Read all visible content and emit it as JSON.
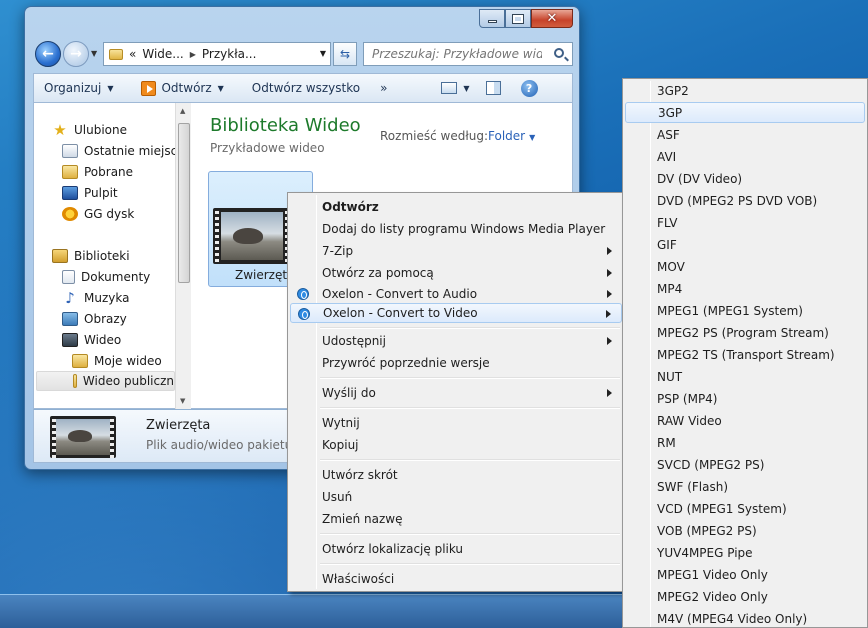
{
  "window": {
    "nav": {
      "back_icon": "back-arrow-icon",
      "forward_icon": "forward-arrow-icon"
    },
    "address": {
      "prefix": "«",
      "crumbs": [
        "Wide...",
        "Przykła..."
      ]
    },
    "search": {
      "placeholder": "Przeszukaj: Przykładowe wideo"
    },
    "toolbar": {
      "organize": "Organizuj",
      "play": "Odtwórz",
      "play_all": "Odtwórz wszystko",
      "more": "»"
    },
    "sidebar": {
      "favorites": [
        {
          "label": "Ulubione",
          "icon": "star-icon"
        },
        {
          "label": "Ostatnie miejsca",
          "icon": "recent-places-icon"
        },
        {
          "label": "Pobrane",
          "icon": "downloads-folder-icon"
        },
        {
          "label": "Pulpit",
          "icon": "desktop-icon"
        },
        {
          "label": "GG dysk",
          "icon": "gg-drive-icon"
        }
      ],
      "libraries": [
        {
          "label": "Biblioteki",
          "icon": "libraries-icon"
        },
        {
          "label": "Dokumenty",
          "icon": "documents-icon"
        },
        {
          "label": "Muzyka",
          "icon": "music-icon"
        },
        {
          "label": "Obrazy",
          "icon": "pictures-icon"
        },
        {
          "label": "Wideo",
          "icon": "videos-icon"
        },
        {
          "label": "Moje wideo",
          "icon": "folder-icon"
        },
        {
          "label": "Wideo publiczn",
          "icon": "folder-icon",
          "selected": true
        }
      ]
    },
    "library": {
      "title": "Biblioteka Wideo",
      "subtitle": "Przykładowe wideo",
      "arrange_label": "Rozmieść według:",
      "arrange_value": "Folder"
    },
    "file": {
      "name": "Zwierzęta"
    },
    "details": {
      "name": "Zwierzęta",
      "type": "Plik audio/wideo pakietu W"
    }
  },
  "context_menu": {
    "items": [
      {
        "label": "Odtwórz",
        "bold": true
      },
      {
        "label": "Dodaj do listy programu Windows Media Player"
      },
      {
        "label": "7-Zip",
        "submenu": true
      },
      {
        "label": "Otwórz za pomocą",
        "submenu": true
      },
      {
        "label": "Oxelon - Convert to Audio",
        "submenu": true,
        "icon": "oxelon-icon"
      },
      {
        "label": "Oxelon - Convert to Video",
        "submenu": true,
        "icon": "oxelon-icon",
        "highlighted": true
      },
      {
        "label": "Udostępnij",
        "submenu": true
      },
      {
        "label": "Przywróć poprzednie wersje"
      },
      {
        "label": "Wyślij do",
        "submenu": true
      },
      {
        "label": "Wytnij"
      },
      {
        "label": "Kopiuj"
      },
      {
        "label": "Utwórz skrót"
      },
      {
        "label": "Usuń"
      },
      {
        "label": "Zmień nazwę"
      },
      {
        "label": "Otwórz lokalizację pliku"
      },
      {
        "label": "Właściwości"
      }
    ]
  },
  "formats_menu": {
    "highlighted": "3GP",
    "items": [
      "3GP2",
      "3GP",
      "ASF",
      "AVI",
      "DV (DV Video)",
      "DVD (MPEG2 PS DVD VOB)",
      "FLV",
      "GIF",
      "MOV",
      "MP4",
      "MPEG1 (MPEG1 System)",
      "MPEG2 PS (Program Stream)",
      "MPEG2 TS (Transport Stream)",
      "NUT",
      "PSP (MP4)",
      "RAW Video",
      "RM",
      "SVCD (MPEG2 PS)",
      "SWF (Flash)",
      "VCD (MPEG1 System)",
      "VOB (MPEG2 PS)",
      "YUV4MPEG Pipe",
      "MPEG1 Video Only",
      "MPEG2 Video Only",
      "M4V (MPEG4 Video Only)"
    ]
  }
}
